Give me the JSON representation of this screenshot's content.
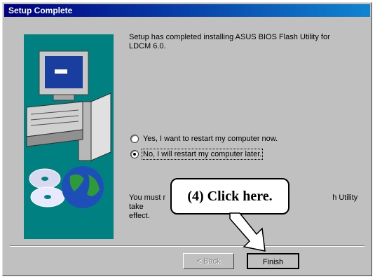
{
  "window": {
    "title": "Setup Complete"
  },
  "message": "Setup has completed installing ASUS BIOS Flash Utility for LDCM 6.0.",
  "options": [
    {
      "label": "Yes, I want to restart my computer now.",
      "selected": false
    },
    {
      "label": "No, I will restart my computer later.",
      "selected": true
    }
  ],
  "note": {
    "left": "You must r",
    "right": "h Utility take",
    "second_line": "effect."
  },
  "buttons": {
    "back": "< Back",
    "finish": "Finish"
  },
  "callout": {
    "text": "(4)  Click here."
  },
  "colors": {
    "title_start": "#000080",
    "title_end": "#1084d0",
    "art_bg": "#008080",
    "dialog_bg": "#c0c0c0"
  }
}
